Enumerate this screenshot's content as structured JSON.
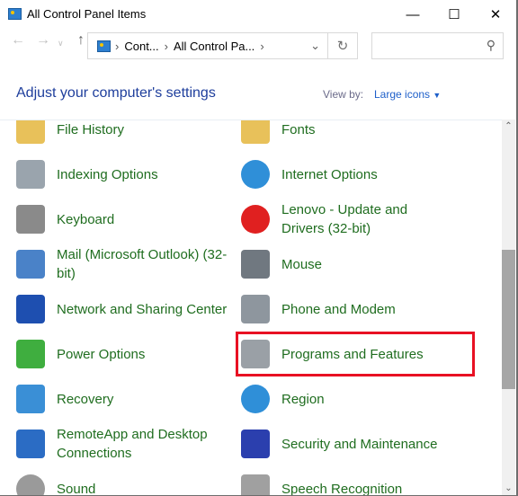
{
  "window": {
    "title": "All Control Panel Items",
    "icon": "control-panel-icon"
  },
  "address": {
    "crumbs": [
      "Cont...",
      "All Control Pa..."
    ],
    "search_placeholder": ""
  },
  "header": {
    "title": "Adjust your computer's settings",
    "view_by_label": "View by:",
    "view_by_value": "Large icons"
  },
  "items_left": [
    {
      "label": "File History",
      "icon": "file-history-icon",
      "color": "#e8c15a"
    },
    {
      "label": "Indexing Options",
      "icon": "indexing-options-icon",
      "color": "#9aa4ad"
    },
    {
      "label": "Keyboard",
      "icon": "keyboard-icon",
      "color": "#8a8a8a"
    },
    {
      "label": "Mail (Microsoft Outlook) (32-bit)",
      "icon": "mail-icon",
      "color": "#4a82c8"
    },
    {
      "label": "Network and Sharing Center",
      "icon": "network-icon",
      "color": "#1e4fb0"
    },
    {
      "label": "Power Options",
      "icon": "power-options-icon",
      "color": "#3fae3f"
    },
    {
      "label": "Recovery",
      "icon": "recovery-icon",
      "color": "#3a8fd6"
    },
    {
      "label": "RemoteApp and Desktop Connections",
      "icon": "remoteapp-icon",
      "color": "#2b6cc4"
    },
    {
      "label": "Sound",
      "icon": "sound-icon",
      "color": "#9a9a9a"
    }
  ],
  "items_right": [
    {
      "label": "Fonts",
      "icon": "fonts-icon",
      "color": "#e8c15a"
    },
    {
      "label": "Internet Options",
      "icon": "internet-options-icon",
      "color": "#2f8fd8"
    },
    {
      "label": "Lenovo - Update and Drivers (32-bit)",
      "icon": "lenovo-update-icon",
      "color": "#e02020"
    },
    {
      "label": "Mouse",
      "icon": "mouse-icon",
      "color": "#707880"
    },
    {
      "label": "Phone and Modem",
      "icon": "phone-modem-icon",
      "color": "#8e969e"
    },
    {
      "label": "Programs and Features",
      "icon": "programs-features-icon",
      "color": "#9aa0a6"
    },
    {
      "label": "Region",
      "icon": "region-icon",
      "color": "#2f8fd8"
    },
    {
      "label": "Security and Maintenance",
      "icon": "security-flag-icon",
      "color": "#2b3fae"
    },
    {
      "label": "Speech Recognition",
      "icon": "microphone-icon",
      "color": "#a0a0a0"
    }
  ],
  "highlight_color": "#e81123"
}
